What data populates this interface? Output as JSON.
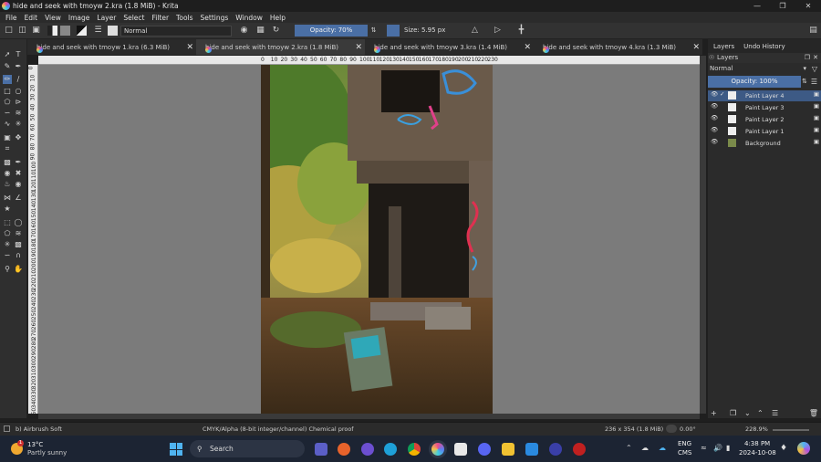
{
  "window": {
    "title": "hide and seek with tmoyw 2.kra (1.8 MiB)  - Krita"
  },
  "menu": [
    "File",
    "Edit",
    "View",
    "Image",
    "Layer",
    "Select",
    "Filter",
    "Tools",
    "Settings",
    "Window",
    "Help"
  ],
  "toolbar": {
    "blend_mode": "Normal",
    "opacity": "Opacity: 70%",
    "size": "Size: 5.95 px"
  },
  "tabs": [
    {
      "label": "hide and seek with tmoyw 1.kra (6.3 MiB)",
      "active": false
    },
    {
      "label": "hide and seek with tmoyw 2.kra (1.8 MiB)",
      "active": true
    },
    {
      "label": "hide and seek with tmoyw 3.kra (1.4 MiB)",
      "active": false
    },
    {
      "label": "hide and seek with tmoyw 4.kra (1.3 MiB)",
      "active": false
    }
  ],
  "ruler_h": [
    "0",
    "10",
    "20",
    "30",
    "40",
    "50",
    "60",
    "70",
    "80",
    "90",
    "100",
    "110",
    "120",
    "130",
    "140",
    "150",
    "160",
    "170",
    "180",
    "190",
    "200",
    "210",
    "220",
    "230"
  ],
  "ruler_v": [
    "0",
    "10",
    "20",
    "30",
    "40",
    "50",
    "60",
    "70",
    "80",
    "90",
    "100",
    "110",
    "120",
    "130",
    "140",
    "150",
    "160",
    "170",
    "180",
    "190",
    "200",
    "210",
    "220",
    "230",
    "240",
    "250",
    "260",
    "270",
    "280",
    "290",
    "300",
    "310",
    "320",
    "330",
    "340",
    "350"
  ],
  "docker": {
    "tab_layers": "Layers",
    "tab_undo": "Undo History",
    "panel_title": "Layers",
    "blend": "Normal",
    "opacity": "Opacity:  100%",
    "layers": [
      {
        "name": "Paint Layer 4",
        "selected": true
      },
      {
        "name": "Paint Layer 3",
        "selected": false
      },
      {
        "name": "Paint Layer 2",
        "selected": false
      },
      {
        "name": "Paint Layer 1",
        "selected": false
      },
      {
        "name": "Background",
        "selected": false
      }
    ]
  },
  "status": {
    "brush": "b) Airbrush Soft",
    "colorspace": "CMYK/Alpha (8-bit integer/channel)  Chemical proof",
    "dimensions": "236 x 354 (1.8 MiB)",
    "rotation": "0.00°",
    "zoom": "228.9%"
  },
  "taskbar": {
    "weather_temp": "13°C",
    "weather_desc": "Partly sunny",
    "weather_badge": "1",
    "search": "Search",
    "lang": "ENG",
    "lang2": "CMS",
    "time": "4:38 PM",
    "date": "2024-10-08"
  },
  "colors": {
    "accent": "#4a6fa5",
    "canvas_bg": "#7b7b7b",
    "taskbar": "#1c2433"
  }
}
